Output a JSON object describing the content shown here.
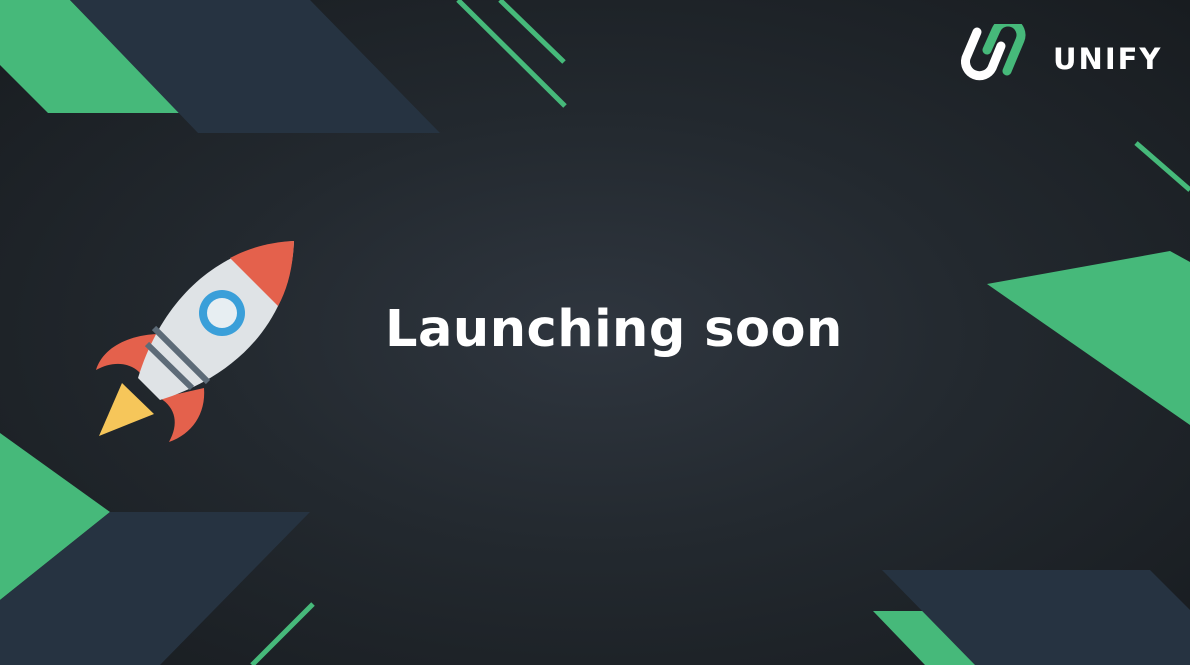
{
  "brand": {
    "name": "UNIFY",
    "logo_icon": "unify-logo-icon"
  },
  "hero": {
    "headline": "Launching soon",
    "icon": "rocket-icon"
  },
  "colors": {
    "background": "#23292f",
    "accent_green": "#46b97a",
    "shape_slate": "#263341",
    "text": "#ffffff",
    "rocket_body": "#dfe3e6",
    "rocket_red": "#e4614c",
    "rocket_window": "#3a9fd9",
    "rocket_flame": "#f6c65a"
  }
}
